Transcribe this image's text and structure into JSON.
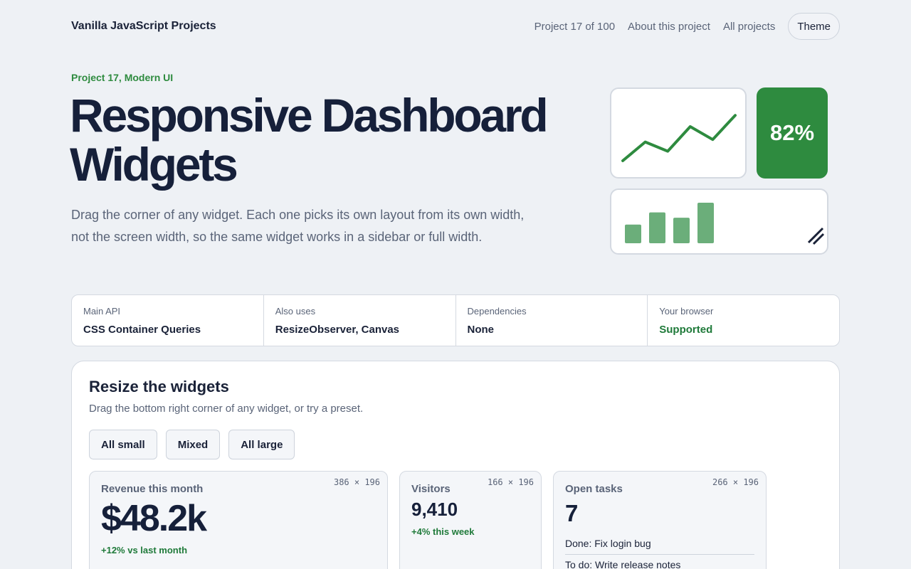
{
  "header": {
    "brand": "Vanilla JavaScript Projects",
    "nav": {
      "progress": "Project 17 of 100",
      "about": "About this project",
      "all": "All projects",
      "theme": "Theme"
    }
  },
  "hero": {
    "eyebrow": "Project 17, Modern UI",
    "title": "Responsive Dashboard Widgets",
    "description": "Drag the corner of any widget. Each one picks its own layout from its own width, not the screen width, so the same widget works in a sidebar or full width."
  },
  "illustration": {
    "percent": "82%",
    "accent": "#2e8b3f",
    "bar_color": "#6bae7a",
    "line_values": [
      0,
      0.55,
      0.28,
      1.0,
      0.62,
      1.33
    ],
    "bar_values": [
      0.46,
      0.76,
      0.63,
      1.0
    ]
  },
  "facts": [
    {
      "label": "Main API",
      "value": "CSS Container Queries"
    },
    {
      "label": "Also uses",
      "value": "ResizeObserver, Canvas"
    },
    {
      "label": "Dependencies",
      "value": "None"
    },
    {
      "label": "Your browser",
      "value": "Supported"
    }
  ],
  "panel": {
    "title": "Resize the widgets",
    "subtitle": "Drag the bottom right corner of any widget, or try a preset.",
    "presets": [
      "All small",
      "Mixed",
      "All large"
    ],
    "widgets": {
      "revenue": {
        "title": "Revenue this month",
        "size": "386 × 196",
        "value": "$48.2k",
        "delta": "+12% vs last month"
      },
      "visitors": {
        "title": "Visitors",
        "size": "166 × 196",
        "value": "9,410",
        "delta": "+4% this week"
      },
      "tasks": {
        "title": "Open tasks",
        "size": "266 × 196",
        "value": "7",
        "items": [
          "Done: Fix login bug",
          "To do: Write release notes"
        ]
      }
    }
  }
}
